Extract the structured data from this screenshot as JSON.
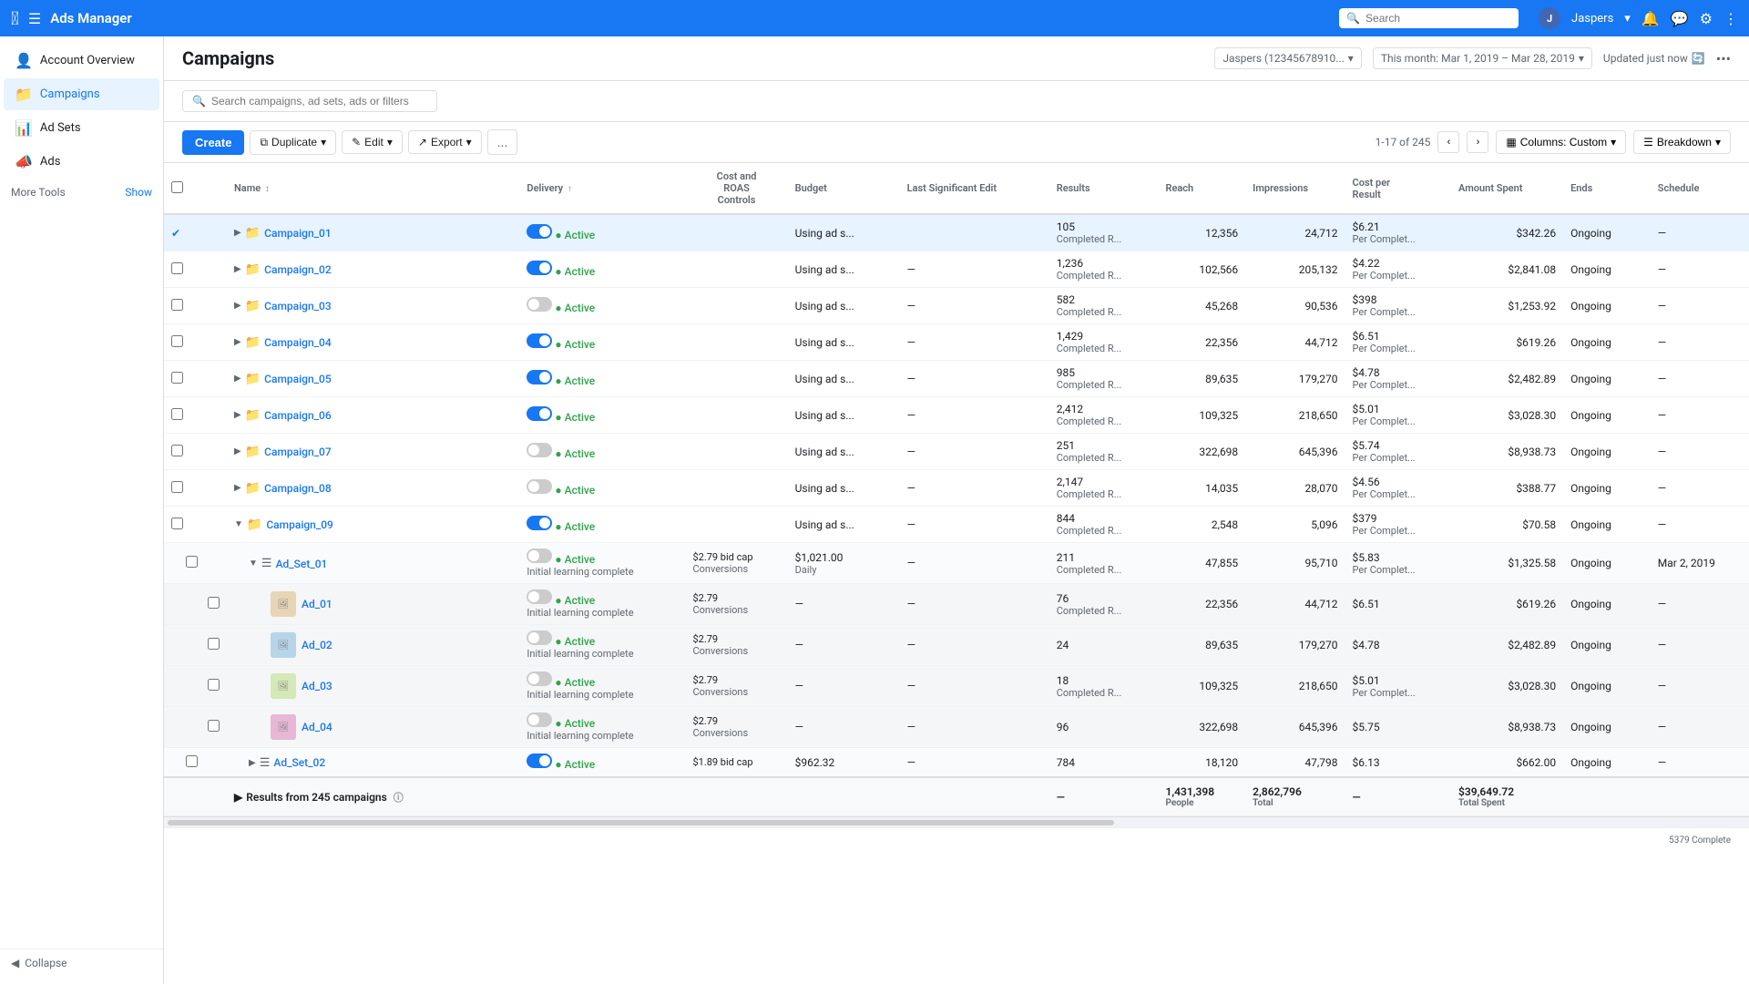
{
  "app": {
    "logo": "f",
    "title": "Ads Manager"
  },
  "topbar": {
    "search_placeholder": "Search",
    "user_name": "Jaspers",
    "user_dropdown": "▾",
    "notification_icon": "🔔",
    "message_icon": "💬",
    "settings_icon": "⚙",
    "more_icon": "☰"
  },
  "sidebar": {
    "items": [
      {
        "id": "account-overview",
        "label": "Account Overview",
        "icon": "👤"
      },
      {
        "id": "campaigns",
        "label": "Campaigns",
        "icon": "📁",
        "active": true
      },
      {
        "id": "ad-sets",
        "label": "Ad Sets",
        "icon": "📊"
      },
      {
        "id": "ads",
        "label": "Ads",
        "icon": "📣"
      }
    ],
    "more_tools_label": "More Tools",
    "show_label": "Show",
    "collapse_label": "Collapse"
  },
  "page": {
    "title": "Campaigns"
  },
  "header": {
    "account": "Jaspers (12345678910...",
    "date_range": "This month: Mar 1, 2019 – Mar 28, 2019",
    "updated": "Updated just now"
  },
  "toolbar": {
    "search_placeholder": "Search campaigns, ad sets, ads or filters"
  },
  "actionbar": {
    "create_label": "Create",
    "duplicate_label": "Duplicate",
    "edit_label": "Edit",
    "export_label": "Export",
    "more_label": "...",
    "pagination": "1-17 of 245",
    "columns_label": "Columns: Custom",
    "breakdown_label": "Breakdown"
  },
  "table": {
    "headers": [
      {
        "id": "checkbox",
        "label": ""
      },
      {
        "id": "name",
        "label": "Name"
      },
      {
        "id": "sort1",
        "label": ""
      },
      {
        "id": "sort2",
        "label": ""
      },
      {
        "id": "delivery",
        "label": "Delivery"
      },
      {
        "id": "cost_roas",
        "label": "Cost and\nROAS\nControls"
      },
      {
        "id": "budget",
        "label": "Budget"
      },
      {
        "id": "last_edit",
        "label": "Last Significant Edit"
      },
      {
        "id": "results",
        "label": "Results"
      },
      {
        "id": "reach",
        "label": "Reach"
      },
      {
        "id": "impressions",
        "label": "Impressions"
      },
      {
        "id": "cpr",
        "label": "Cost per\nResult"
      },
      {
        "id": "amount_spent",
        "label": "Amount Spent"
      },
      {
        "id": "ends",
        "label": "Ends"
      },
      {
        "id": "schedule",
        "label": "Schedule"
      }
    ],
    "rows": [
      {
        "id": "campaign_01",
        "type": "campaign",
        "level": 0,
        "selected": true,
        "expanded": true,
        "name": "Campaign_01",
        "toggle": true,
        "delivery": "Active",
        "cost_roas": "",
        "budget": "Using ad s...",
        "last_edit": "",
        "results": "105",
        "results_sub": "Completed R...",
        "reach": "12,356",
        "impressions": "24,712",
        "cpr": "$6.21",
        "cpr_sub": "Per Complet...",
        "amount_spent": "$342.26",
        "ends": "Ongoing",
        "schedule": "—"
      },
      {
        "id": "campaign_02",
        "type": "campaign",
        "level": 0,
        "selected": false,
        "expanded": false,
        "name": "Campaign_02",
        "toggle": true,
        "delivery": "Active",
        "cost_roas": "",
        "budget": "Using ad s...",
        "last_edit": "—",
        "results": "1,236",
        "results_sub": "Completed R...",
        "reach": "102,566",
        "impressions": "205,132",
        "cpr": "$4.22",
        "cpr_sub": "Per Complet...",
        "amount_spent": "$2,841.08",
        "ends": "Ongoing",
        "schedule": "—"
      },
      {
        "id": "campaign_03",
        "type": "campaign",
        "level": 0,
        "selected": false,
        "expanded": false,
        "name": "Campaign_03",
        "toggle": false,
        "delivery": "Active",
        "cost_roas": "",
        "budget": "Using ad s...",
        "last_edit": "—",
        "results": "582",
        "results_sub": "Completed R...",
        "reach": "45,268",
        "impressions": "90,536",
        "cpr": "$398",
        "cpr_sub": "Per Complet...",
        "amount_spent": "$1,253.92",
        "ends": "Ongoing",
        "schedule": "—"
      },
      {
        "id": "campaign_04",
        "type": "campaign",
        "level": 0,
        "selected": false,
        "expanded": false,
        "name": "Campaign_04",
        "toggle": true,
        "delivery": "Active",
        "cost_roas": "",
        "budget": "Using ad s...",
        "last_edit": "—",
        "results": "1,429",
        "results_sub": "Completed R...",
        "reach": "22,356",
        "impressions": "44,712",
        "cpr": "$6.51",
        "cpr_sub": "Per Complet...",
        "amount_spent": "$619.26",
        "ends": "Ongoing",
        "schedule": "—"
      },
      {
        "id": "campaign_05",
        "type": "campaign",
        "level": 0,
        "selected": false,
        "expanded": false,
        "name": "Campaign_05",
        "toggle": true,
        "delivery": "Active",
        "cost_roas": "",
        "budget": "Using ad s...",
        "last_edit": "—",
        "results": "985",
        "results_sub": "Completed R...",
        "reach": "89,635",
        "impressions": "179,270",
        "cpr": "$4.78",
        "cpr_sub": "Per Complet...",
        "amount_spent": "$2,482.89",
        "ends": "Ongoing",
        "schedule": "—"
      },
      {
        "id": "campaign_06",
        "type": "campaign",
        "level": 0,
        "selected": false,
        "expanded": false,
        "name": "Campaign_06",
        "toggle": true,
        "delivery": "Active",
        "cost_roas": "",
        "budget": "Using ad s...",
        "last_edit": "—",
        "results": "2,412",
        "results_sub": "Completed R...",
        "reach": "109,325",
        "impressions": "218,650",
        "cpr": "$5.01",
        "cpr_sub": "Per Complet...",
        "amount_spent": "$3,028.30",
        "ends": "Ongoing",
        "schedule": "—"
      },
      {
        "id": "campaign_07",
        "type": "campaign",
        "level": 0,
        "selected": false,
        "expanded": false,
        "name": "Campaign_07",
        "toggle": false,
        "delivery": "Active",
        "cost_roas": "",
        "budget": "Using ad s...",
        "last_edit": "—",
        "results": "251",
        "results_sub": "Completed R...",
        "reach": "322,698",
        "impressions": "645,396",
        "cpr": "$5.74",
        "cpr_sub": "Per Complet...",
        "amount_spent": "$8,938.73",
        "ends": "Ongoing",
        "schedule": "—"
      },
      {
        "id": "campaign_08",
        "type": "campaign",
        "level": 0,
        "selected": false,
        "expanded": false,
        "name": "Campaign_08",
        "toggle": false,
        "delivery": "Active",
        "cost_roas": "",
        "budget": "Using ad s...",
        "last_edit": "—",
        "results": "2,147",
        "results_sub": "Completed R...",
        "reach": "14,035",
        "impressions": "28,070",
        "cpr": "$4.56",
        "cpr_sub": "Per Complet...",
        "amount_spent": "$388.77",
        "ends": "Ongoing",
        "schedule": "—"
      },
      {
        "id": "campaign_09",
        "type": "campaign",
        "level": 0,
        "selected": false,
        "expanded": true,
        "name": "Campaign_09",
        "toggle": true,
        "delivery": "Active",
        "cost_roas": "",
        "budget": "Using ad s...",
        "last_edit": "—",
        "results": "844",
        "results_sub": "Completed R...",
        "reach": "2,548",
        "impressions": "5,096",
        "cpr": "$379",
        "cpr_sub": "Per Complet...",
        "amount_spent": "$70.58",
        "ends": "Ongoing",
        "schedule": "—"
      }
    ],
    "adset_rows": [
      {
        "id": "ad_set_01",
        "type": "adset",
        "level": 1,
        "name": "Ad_Set_01",
        "toggle": false,
        "delivery": "Active",
        "delivery_sub": "Initial learning complete",
        "cost_roas": "$2.79 bid cap\nConversions",
        "bid_cap": "$2.79 bid cap",
        "bid_type": "Conversions",
        "budget": "$1,021.00\nDaily",
        "budget_val": "$1,021.00",
        "budget_type": "Daily",
        "last_edit": "—",
        "results": "211",
        "results_sub": "Completed R...",
        "reach": "47,855",
        "impressions": "95,710",
        "cpr": "$5.83",
        "cpr_sub": "Per Complet...",
        "amount_spent": "$1,325.58",
        "ends": "Ongoing",
        "schedule": "Mar 2, 2019"
      }
    ],
    "ad_rows": [
      {
        "id": "ad_01",
        "type": "ad",
        "level": 2,
        "name": "Ad_01",
        "thumb_class": "ad-thumb-1",
        "toggle": false,
        "delivery": "Active",
        "delivery_sub": "Initial learning complete",
        "cost_roas": "$2.79\nConversions",
        "budget": "—",
        "last_edit": "—",
        "results": "76",
        "results_sub": "Completed R...",
        "reach": "22,356",
        "impressions": "44,712",
        "cpr": "$6.51",
        "cpr_sub": "",
        "amount_spent": "$619.26",
        "ends": "Ongoing",
        "schedule": "—"
      },
      {
        "id": "ad_02",
        "type": "ad",
        "level": 2,
        "name": "Ad_02",
        "thumb_class": "ad-thumb-2",
        "toggle": false,
        "delivery": "Active",
        "delivery_sub": "Initial learning complete",
        "cost_roas": "$2.79\nConversions",
        "budget": "—",
        "last_edit": "—",
        "results": "24",
        "results_sub": "",
        "reach": "89,635",
        "impressions": "179,270",
        "cpr": "$4.78",
        "cpr_sub": "",
        "amount_spent": "$2,482.89",
        "ends": "Ongoing",
        "schedule": "—"
      },
      {
        "id": "ad_03",
        "type": "ad",
        "level": 2,
        "name": "Ad_03",
        "thumb_class": "ad-thumb-3",
        "toggle": false,
        "delivery": "Active",
        "delivery_sub": "Initial learning complete",
        "cost_roas": "$2.79\nConversions",
        "budget": "—",
        "last_edit": "—",
        "results": "18",
        "results_sub": "Completed R...",
        "reach": "109,325",
        "impressions": "218,650",
        "cpr": "$5.01",
        "cpr_sub": "Per Complet...",
        "amount_spent": "$3,028.30",
        "ends": "Ongoing",
        "schedule": "—"
      },
      {
        "id": "ad_04",
        "type": "ad",
        "level": 2,
        "name": "Ad_04",
        "thumb_class": "ad-thumb-4",
        "toggle": false,
        "delivery": "Active",
        "delivery_sub": "Initial learning complete",
        "cost_roas": "$2.79\nConversions",
        "budget": "—",
        "last_edit": "—",
        "results": "96",
        "results_sub": "",
        "reach": "322,698",
        "impressions": "645,396",
        "cpr": "$5.75",
        "cpr_sub": "",
        "amount_spent": "$8,938.73",
        "ends": "Ongoing",
        "schedule": "—"
      }
    ],
    "adset_row_02": {
      "id": "ad_set_02",
      "name": "Ad_Set_02",
      "toggle": true,
      "delivery": "Active",
      "bid_cap": "$1.89 bid cap",
      "budget": "$962.32",
      "last_edit": "—",
      "results": "784",
      "reach": "18,120",
      "impressions": "47,798",
      "cpr": "$6.13",
      "amount_spent": "$662.00",
      "ends": "Ongoing",
      "schedule": "—"
    },
    "totals": {
      "label": "Results from 245 campaigns",
      "results": "—",
      "reach": "1,431,398",
      "reach_label": "People",
      "impressions": "2,862,796",
      "impressions_label": "Total",
      "cpr": "—",
      "amount_spent": "$39,649.72",
      "amount_spent_label": "Total Spent"
    },
    "complete_badge": "5379 Complete"
  }
}
